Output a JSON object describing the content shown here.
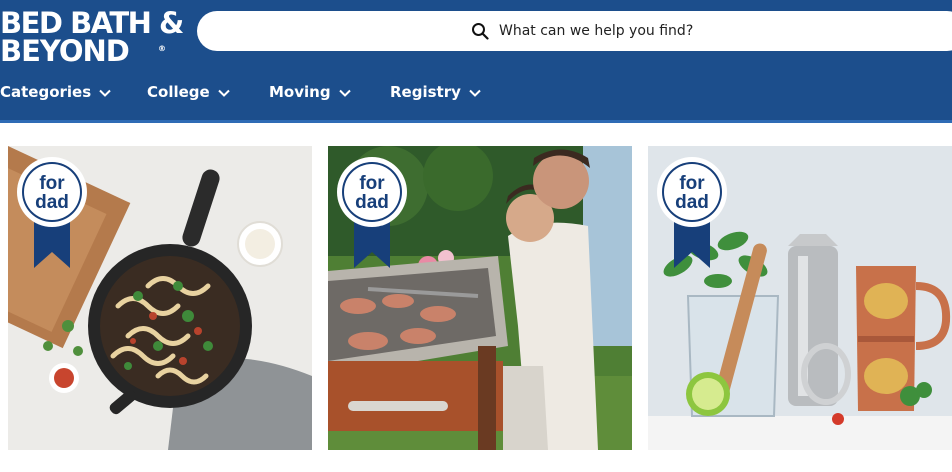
{
  "brand": {
    "line1": "BED BATH &",
    "line2": "BEYOND",
    "registered": "®"
  },
  "search": {
    "placeholder": "What can we help you find?",
    "icon": "search-icon"
  },
  "nav": {
    "items": [
      {
        "label": "Categories",
        "icon": "chevron-down-icon"
      },
      {
        "label": "College",
        "icon": "chevron-down-icon"
      },
      {
        "label": "Moving",
        "icon": "chevron-down-icon"
      },
      {
        "label": "Registry",
        "icon": "chevron-down-icon"
      }
    ]
  },
  "tiles": [
    {
      "badge": {
        "line1": "for",
        "line2": "dad"
      },
      "subject": "skillet-pasta"
    },
    {
      "badge": {
        "line1": "for",
        "line2": "dad"
      },
      "subject": "grilling-dad-and-son"
    },
    {
      "badge": {
        "line1": "for",
        "line2": "dad"
      },
      "subject": "copper-barware"
    }
  ],
  "colors": {
    "header": "#1c4e8c",
    "header_accent": "#2e6bb5",
    "badge_navy": "#173f7a",
    "white": "#ffffff"
  }
}
